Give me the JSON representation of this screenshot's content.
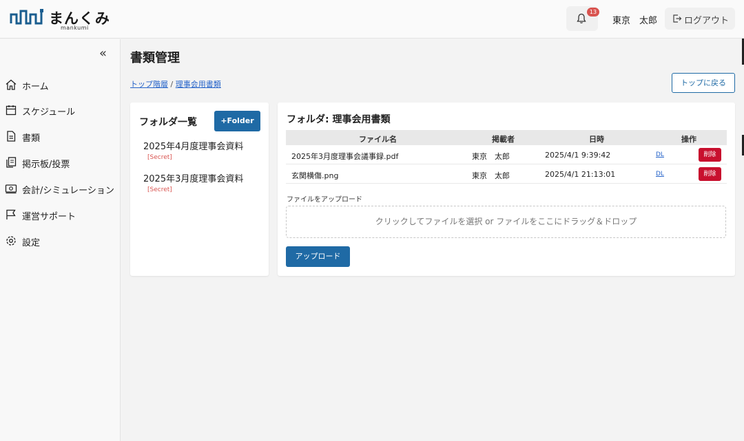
{
  "header": {
    "logo_text": "まんくみ",
    "logo_sub": "mankumi",
    "notification_count": "13",
    "user_name": "東京　太郎",
    "logout_label": "ログアウト"
  },
  "sidebar": {
    "items": [
      {
        "label": "ホーム",
        "icon": "home-icon"
      },
      {
        "label": "スケジュール",
        "icon": "calendar-icon"
      },
      {
        "label": "書類",
        "icon": "document-icon"
      },
      {
        "label": "掲示板/投票",
        "icon": "board-icon"
      },
      {
        "label": "会計/シミュレーション",
        "icon": "accounting-icon"
      },
      {
        "label": "運営サポート",
        "icon": "flag-icon"
      },
      {
        "label": "設定",
        "icon": "gear-icon"
      }
    ]
  },
  "page": {
    "title": "書類管理",
    "breadcrumb": {
      "root": "トップ階層",
      "separator": " / ",
      "current": "理事会用書類"
    },
    "back_button": "トップに戻る"
  },
  "folders": {
    "title": "フォルダ一覧",
    "add_button": "+Folder",
    "items": [
      {
        "name": "2025年4月度理事会資料",
        "tag": "[Secret]"
      },
      {
        "name": "2025年3月度理事会資料",
        "tag": "[Secret]"
      }
    ]
  },
  "files": {
    "title": "フォルダ: 理事会用書類",
    "columns": [
      "ファイル名",
      "掲載者",
      "日時",
      "操作"
    ],
    "rows": [
      {
        "name": "2025年3月度理事会議事録.pdf",
        "author": "東京　太郎",
        "datetime": "2025/4/1 9:39:42",
        "dl": "DL",
        "delete": "削除"
      },
      {
        "name": "玄関横傷.png",
        "author": "東京　太郎",
        "datetime": "2025/4/1 21:13:01",
        "dl": "DL",
        "delete": "削除"
      }
    ],
    "upload_label": "ファイルをアップロード",
    "dropzone_text": "クリックしてファイルを選択 or ファイルをここにドラッグ＆ドロップ",
    "upload_button": "アップロード"
  },
  "colors": {
    "primary": "#1f6aa5",
    "danger": "#c8102e",
    "link": "#2563c9",
    "badge": "#d9534f"
  }
}
